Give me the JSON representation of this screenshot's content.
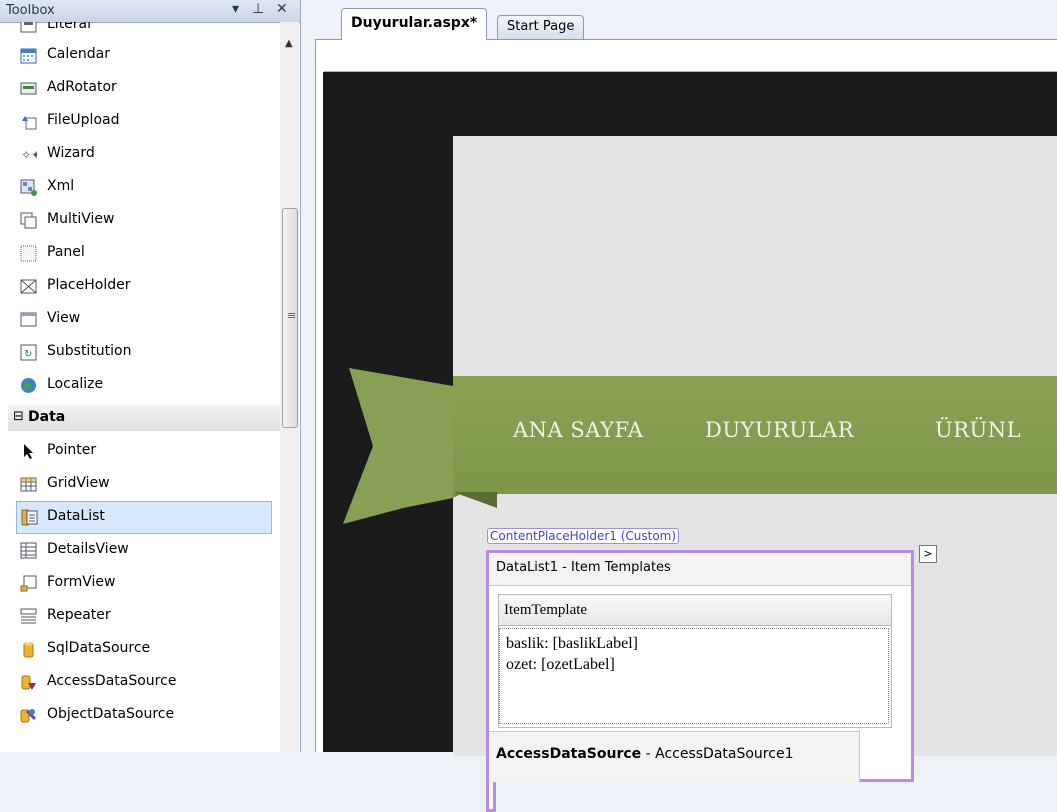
{
  "toolbox": {
    "title": "Toolbox",
    "controls": {
      "dropdown": "▾",
      "pin": "⊥",
      "close": "✕"
    },
    "items": [
      {
        "label": "Literal",
        "icon": "literal-icon"
      },
      {
        "label": "Calendar",
        "icon": "calendar-icon"
      },
      {
        "label": "AdRotator",
        "icon": "adrotator-icon"
      },
      {
        "label": "FileUpload",
        "icon": "fileupload-icon"
      },
      {
        "label": "Wizard",
        "icon": "wizard-icon"
      },
      {
        "label": "Xml",
        "icon": "xml-icon"
      },
      {
        "label": "MultiView",
        "icon": "multiview-icon"
      },
      {
        "label": "Panel",
        "icon": "panel-icon"
      },
      {
        "label": "PlaceHolder",
        "icon": "placeholder-icon"
      },
      {
        "label": "View",
        "icon": "view-icon"
      },
      {
        "label": "Substitution",
        "icon": "substitution-icon"
      },
      {
        "label": "Localize",
        "icon": "localize-icon"
      }
    ],
    "category": {
      "label": "Data",
      "toggle": "⊟"
    },
    "data_items": [
      {
        "label": "Pointer",
        "icon": "pointer-icon"
      },
      {
        "label": "GridView",
        "icon": "gridview-icon"
      },
      {
        "label": "DataList",
        "icon": "datalist-icon",
        "selected": true
      },
      {
        "label": "DetailsView",
        "icon": "detailsview-icon"
      },
      {
        "label": "FormView",
        "icon": "formview-icon"
      },
      {
        "label": "Repeater",
        "icon": "repeater-icon"
      },
      {
        "label": "SqlDataSource",
        "icon": "sqldatasource-icon"
      },
      {
        "label": "AccessDataSource",
        "icon": "accessdatasource-icon"
      },
      {
        "label": "ObjectDataSource",
        "icon": "objectdatasource-icon"
      }
    ]
  },
  "tabs": [
    {
      "label": "Duyurular.aspx*",
      "active": true
    },
    {
      "label": "Start Page",
      "active": false
    }
  ],
  "page": {
    "nav": [
      "ANA SAYFA",
      "DUYURULAR",
      "ÜRÜNL"
    ],
    "colors": {
      "ribbon": "#7d974a",
      "ribbon_dark": "#5a6f33",
      "design_bg": "#1b1b1b",
      "page_bg": "#e4e4e4",
      "selection": "#b98ee0"
    }
  },
  "designer": {
    "content_placeholder_label": "ContentPlaceHolder1 (Custom)",
    "datalist_title": "DataList1 - Item Templates",
    "smart_tag": ">",
    "item_template_title": "ItemTemplate",
    "template_lines": [
      "baslik: [baslikLabel]",
      "ozet: [ozetLabel]"
    ],
    "datasource_type": "AccessDataSource",
    "datasource_sep": " - ",
    "datasource_name": "AccessDataSource1"
  }
}
